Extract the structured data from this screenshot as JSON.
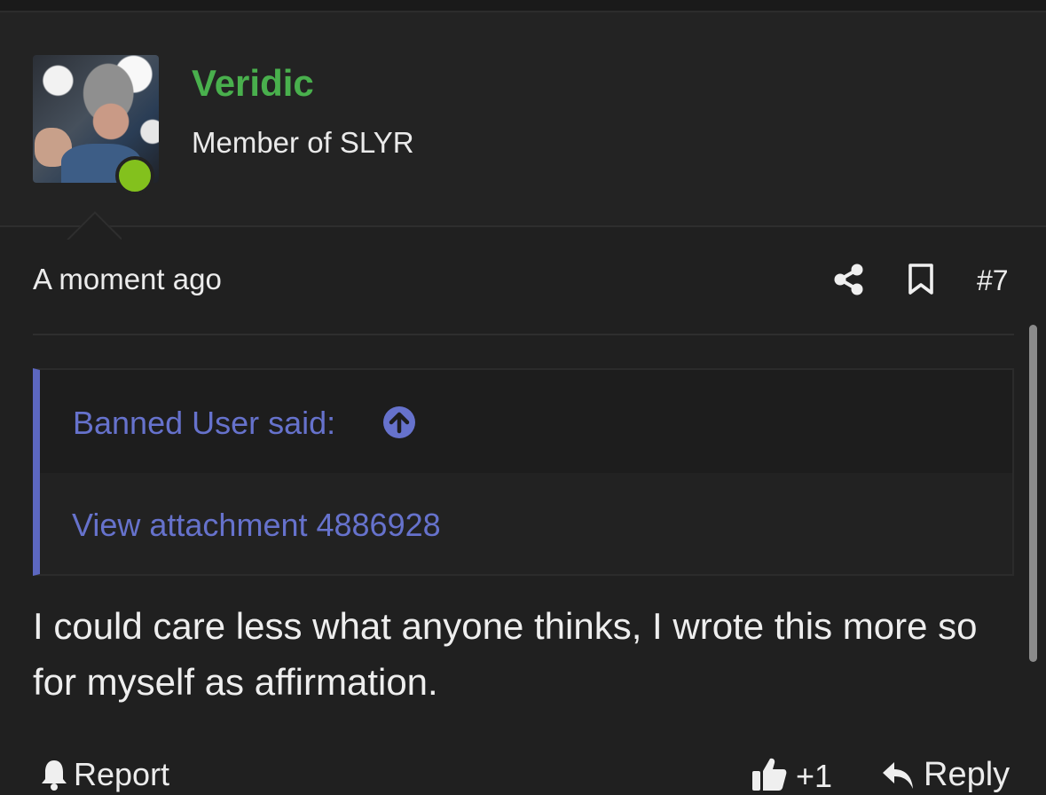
{
  "header": {
    "username": "Veridic",
    "user_title": "Member of SLYR"
  },
  "post": {
    "time": "A moment ago",
    "post_number": "#7",
    "quote": {
      "author": "Banned User said:",
      "attachment_link": "View attachment 4886928"
    },
    "message": "I could care less what anyone thinks, I wrote this more so for myself as affirmation."
  },
  "footer": {
    "report_label": "Report",
    "reaction_count": "+1",
    "reply_label": "Reply"
  },
  "colors": {
    "background": "#202020",
    "username": "#49b04d",
    "online_status": "#83c11d",
    "quote_link": "#6672cc"
  },
  "icons": [
    "share-icon",
    "bookmark-icon",
    "goto-arrow-icon",
    "bell-icon",
    "thumbs-up-icon",
    "reply-arrow-icon"
  ]
}
